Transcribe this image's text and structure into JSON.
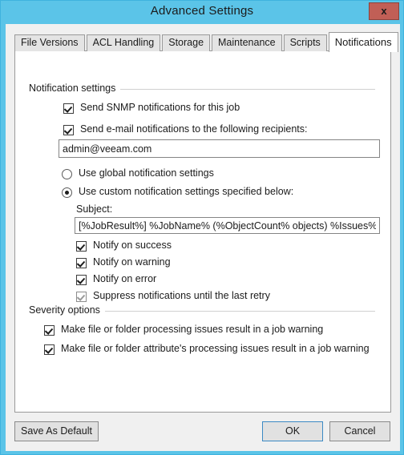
{
  "window": {
    "title": "Advanced Settings",
    "close_label": "x",
    "accent_color": "#5bc4e8",
    "close_color": "#c15f56"
  },
  "tabs": [
    {
      "label": "File Versions",
      "active": false
    },
    {
      "label": "ACL Handling",
      "active": false
    },
    {
      "label": "Storage",
      "active": false
    },
    {
      "label": "Maintenance",
      "active": false
    },
    {
      "label": "Scripts",
      "active": false
    },
    {
      "label": "Notifications",
      "active": true
    }
  ],
  "notification_settings": {
    "group_title": "Notification settings",
    "snmp": {
      "label": "Send SNMP notifications for this job",
      "checked": true
    },
    "email": {
      "label": "Send e-mail notifications to the following recipients:",
      "checked": true
    },
    "recipients": {
      "value": "admin@veeam.com",
      "placeholder": ""
    },
    "mode": {
      "global": {
        "label": "Use global notification settings",
        "selected": false
      },
      "custom": {
        "label": "Use custom notification settings specified below:",
        "selected": true
      }
    },
    "subject": {
      "label": "Subject:",
      "value": "[%JobResult%] %JobName% (%ObjectCount% objects) %Issues%",
      "placeholder": ""
    },
    "notify": [
      {
        "label": "Notify on success",
        "checked": true,
        "disabled": false
      },
      {
        "label": "Notify on warning",
        "checked": true,
        "disabled": false
      },
      {
        "label": "Notify on error",
        "checked": true,
        "disabled": false
      },
      {
        "label": "Suppress notifications until the last retry",
        "checked": true,
        "disabled": true
      }
    ]
  },
  "severity_options": {
    "group_title": "Severity options",
    "items": [
      {
        "label": "Make file or folder processing issues result in a job warning",
        "checked": true
      },
      {
        "label": "Make file or folder attribute's processing issues result in a job warning",
        "checked": true
      }
    ]
  },
  "footer": {
    "save_as_default": "Save As Default",
    "ok": "OK",
    "cancel": "Cancel"
  }
}
